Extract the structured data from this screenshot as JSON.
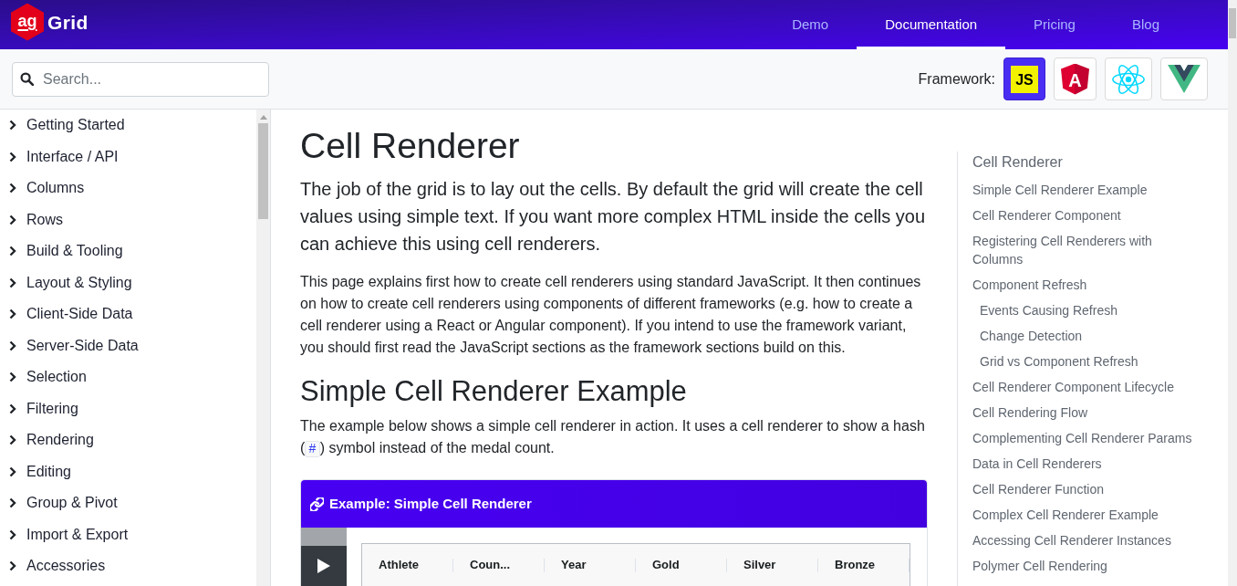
{
  "header": {
    "logo": {
      "mark": "ag",
      "name": "Grid"
    },
    "nav": [
      {
        "label": "Demo",
        "selected": false
      },
      {
        "label": "Documentation",
        "selected": true
      },
      {
        "label": "Pricing",
        "selected": false
      },
      {
        "label": "Blog",
        "selected": false
      }
    ]
  },
  "toolbar": {
    "search": {
      "placeholder": "Search..."
    },
    "framework": {
      "label": "Framework:",
      "options": [
        {
          "kind": "javascript",
          "label": "JS",
          "selected": true
        },
        {
          "kind": "angular",
          "label": "A",
          "selected": false
        },
        {
          "kind": "react",
          "selected": false
        },
        {
          "kind": "vue",
          "selected": false
        }
      ]
    }
  },
  "sidebar": {
    "items": [
      {
        "label": "Getting Started",
        "expanded": false
      },
      {
        "label": "Interface / API",
        "expanded": false
      },
      {
        "label": "Columns",
        "expanded": false
      },
      {
        "label": "Rows",
        "expanded": false
      },
      {
        "label": "Build & Tooling",
        "expanded": false
      },
      {
        "label": "Layout & Styling",
        "expanded": false
      },
      {
        "label": "Client-Side Data",
        "expanded": false
      },
      {
        "label": "Server-Side Data",
        "expanded": false
      },
      {
        "label": "Selection",
        "expanded": false
      },
      {
        "label": "Filtering",
        "expanded": false
      },
      {
        "label": "Rendering",
        "expanded": false
      },
      {
        "label": "Editing",
        "expanded": false
      },
      {
        "label": "Group & Pivot",
        "expanded": false
      },
      {
        "label": "Import & Export",
        "expanded": false
      },
      {
        "label": "Accessories",
        "expanded": false
      }
    ]
  },
  "article": {
    "title": "Cell Renderer",
    "lead": "The job of the grid is to lay out the cells. By default the grid will create the cell values using simple text. If you want more complex HTML inside the cells you can achieve this using cell renderers.",
    "intro": "This page explains first how to create cell renderers using standard JavaScript. It then continues on how to create cell renderers using components of different frameworks (e.g. how to create a cell renderer using a React or Angular component). If you intend to use the framework variant, you should first read the JavaScript sections as the framework sections build on this.",
    "sections": [
      {
        "heading": "Simple Cell Renderer Example",
        "text": {
          "before": "The example below shows a simple cell renderer in action. It uses a cell renderer to show a hash (",
          "code": "#",
          "after": ") symbol instead of the medal count."
        },
        "example": {
          "title": "Example: Simple Cell Renderer",
          "grid": {
            "columns": [
              "Athlete",
              "Coun...",
              "Year",
              "Gold",
              "Silver",
              "Bronze"
            ]
          }
        }
      }
    ]
  },
  "toc": {
    "title": "Cell Renderer",
    "items": [
      {
        "label": "Simple Cell Renderer Example"
      },
      {
        "label": "Cell Renderer Component"
      },
      {
        "label": "Registering Cell Renderers with Columns"
      },
      {
        "label": "Component Refresh",
        "children": [
          {
            "label": "Events Causing Refresh"
          },
          {
            "label": "Change Detection"
          },
          {
            "label": "Grid vs Component Refresh"
          }
        ]
      },
      {
        "label": "Cell Renderer Component Lifecycle"
      },
      {
        "label": "Cell Rendering Flow"
      },
      {
        "label": "Complementing Cell Renderer Params"
      },
      {
        "label": "Data in Cell Renderers"
      },
      {
        "label": "Cell Renderer Function"
      },
      {
        "label": "Complex Cell Renderer Example"
      },
      {
        "label": "Accessing Cell Renderer Instances"
      },
      {
        "label": "Polymer Cell Rendering"
      }
    ]
  }
}
